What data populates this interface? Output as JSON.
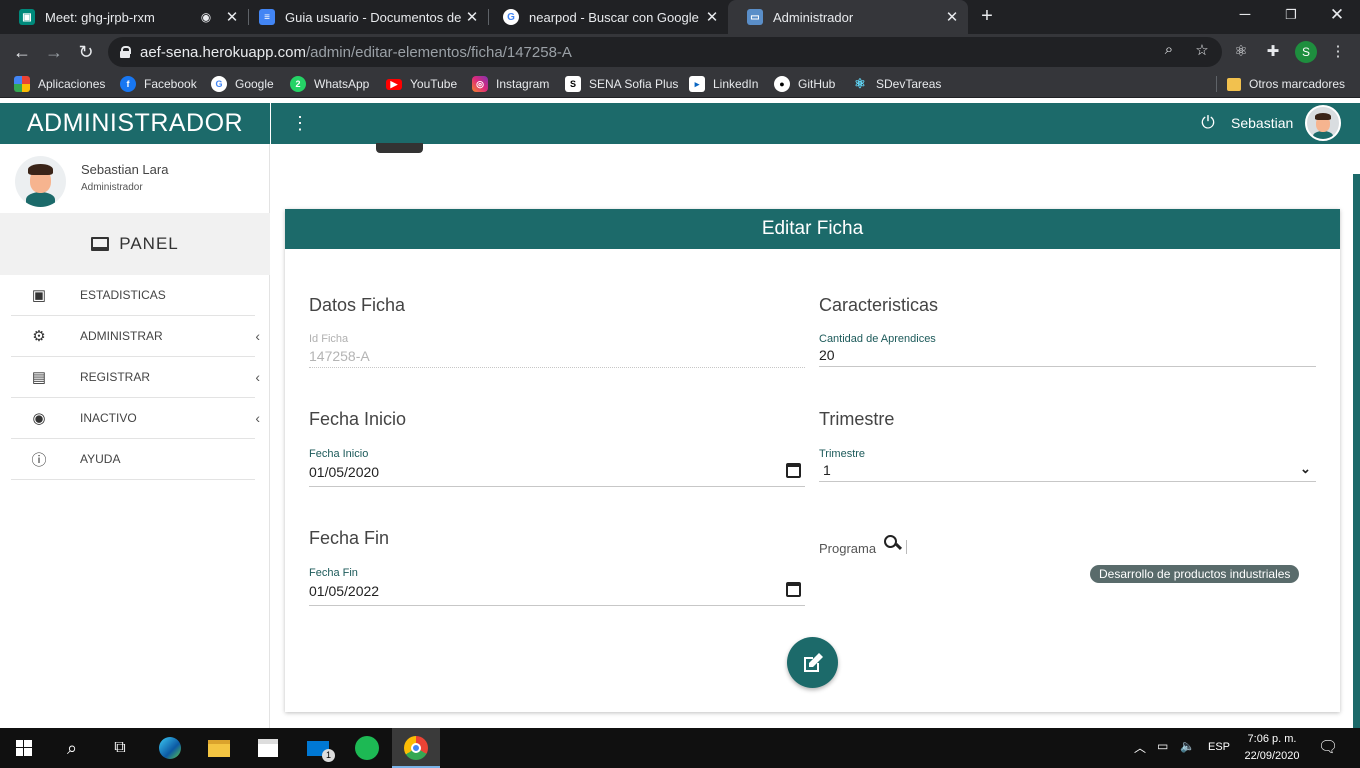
{
  "browser": {
    "tabs": [
      {
        "title": "Meet: ghg-jrpb-rxm",
        "icon": "meet-icon",
        "active": false
      },
      {
        "title": "Guia usuario - Documentos de Google",
        "icon": "docs-icon",
        "active": false
      },
      {
        "title": "nearpod - Buscar con Google",
        "icon": "google-icon",
        "active": false
      },
      {
        "title": "Administrador",
        "icon": "site-icon",
        "active": true
      }
    ],
    "url_host": "aef-sena.herokuapp.com",
    "url_path": "/admin/editar-elementos/ficha/147258-A",
    "profile_initial": "S",
    "bookmarks": [
      {
        "label": "Aplicaciones",
        "icon": "apps-grid-icon"
      },
      {
        "label": "Facebook",
        "icon": "facebook-icon"
      },
      {
        "label": "Google",
        "icon": "google-icon"
      },
      {
        "label": "WhatsApp",
        "icon": "whatsapp-icon"
      },
      {
        "label": "YouTube",
        "icon": "youtube-icon"
      },
      {
        "label": "Instagram",
        "icon": "instagram-icon"
      },
      {
        "label": "SENA Sofia Plus",
        "icon": "sena-icon"
      },
      {
        "label": "LinkedIn",
        "icon": "linkedin-icon"
      },
      {
        "label": "GitHub",
        "icon": "github-icon"
      },
      {
        "label": "SDevTareas",
        "icon": "react-icon"
      }
    ],
    "other_bookmarks": "Otros marcadores"
  },
  "app": {
    "brand": "ADMINISTRADOR",
    "top_user": "Sebastian",
    "sidebar": {
      "user_name": "Sebastian Lara",
      "user_role": "Administrador",
      "panel_label": "PANEL",
      "items": [
        {
          "label": "ESTADISTICAS",
          "icon": "stats-book-icon",
          "submenu": false
        },
        {
          "label": "ADMINISTRAR",
          "icon": "users-cog-icon",
          "submenu": true
        },
        {
          "label": "REGISTRAR",
          "icon": "id-card-icon",
          "submenu": true
        },
        {
          "label": "INACTIVO",
          "icon": "inactive-icon",
          "submenu": true
        },
        {
          "label": "AYUDA",
          "icon": "info-icon",
          "submenu": false
        }
      ]
    },
    "form": {
      "title": "Editar Ficha",
      "datos_title": "Datos Ficha",
      "id_label": "Id Ficha",
      "id_value": "147258-A",
      "caracteristicas_title": "Caracteristicas",
      "cantidad_label": "Cantidad de Aprendices",
      "cantidad_value": "20",
      "fecha_inicio_title": "Fecha Inicio",
      "fecha_inicio_label": "Fecha Inicio",
      "fecha_inicio_value": "01/05/2020",
      "trimestre_title": "Trimestre",
      "trimestre_label": "Trimestre",
      "trimestre_value": "1",
      "fecha_fin_title": "Fecha Fin",
      "fecha_fin_label": "Fecha Fin",
      "fecha_fin_value": "01/05/2022",
      "programa_label": "Programa",
      "programa_chip": "Desarrollo de productos industriales"
    }
  },
  "taskbar": {
    "time": "7:06 p. m.",
    "date": "22/09/2020",
    "language": "ESP",
    "mail_badge": "1"
  },
  "colors": {
    "primary": "#1c6a6a",
    "chrome_dark": "#202124",
    "chrome_toolbar": "#35363a"
  }
}
